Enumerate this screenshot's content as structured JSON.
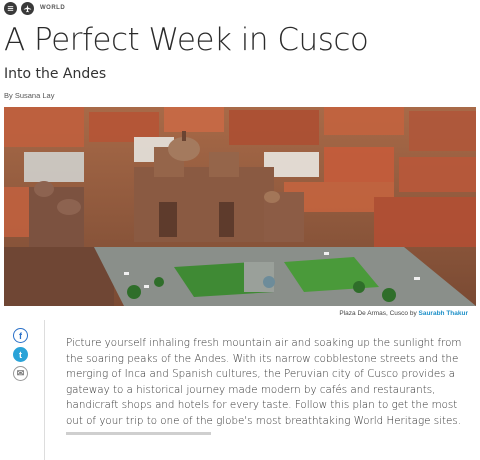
{
  "header": {
    "section": "WORLD",
    "icons": [
      "menu-icon",
      "plane-icon"
    ]
  },
  "article": {
    "title": "A Perfect Week in Cusco",
    "subtitle": "Into the Andes",
    "byline": "By Susana Lay",
    "image_caption": "Plaza De Armas, Cusco by ",
    "image_credit": "Saurabh Thakur",
    "body": "Picture yourself inhaling fresh mountain air and soaking up the sunlight from the soaring peaks of the Andes. With its narrow cobblestone streets and the merging of Inca and Spanish cultures, the Peruvian city of Cusco provides a gateway to a historical journey made modern by cafés and restaurants, handicraft shops and hotels for every taste. Follow this plan to get the most out of your trip to one of the globe's most breathtaking World Heritage sites."
  },
  "share": [
    {
      "name": "facebook-icon",
      "glyph": "f"
    },
    {
      "name": "twitter-icon",
      "glyph": "t"
    },
    {
      "name": "email-icon",
      "glyph": "✉"
    }
  ],
  "colors": {
    "link": "#1e90c8",
    "facebook": "#2a70c8",
    "twitter": "#2aa3d8",
    "rooftops": "#b8553a"
  },
  "reading_progress": 0.35
}
